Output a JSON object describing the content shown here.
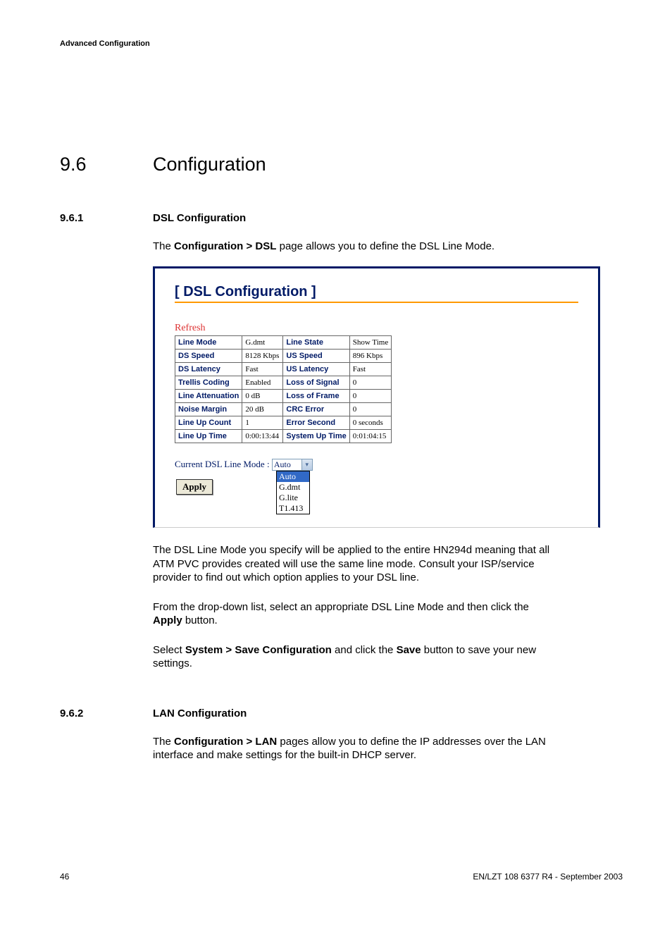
{
  "header": {
    "running": "Advanced Configuration"
  },
  "section": {
    "num": "9.6",
    "title": "Configuration"
  },
  "sub1": {
    "num": "9.6.1",
    "title": "DSL Configuration",
    "intro_pre": "The ",
    "intro_bold": "Configuration > DSL",
    "intro_post": " page allows you to define the DSL Line Mode."
  },
  "panel": {
    "title": "[ DSL Configuration ]",
    "refresh": "Refresh",
    "linemode_label": "Current DSL Line Mode :",
    "selected_option": "Auto",
    "options": [
      "Auto",
      "G.dmt",
      "G.lite",
      "T1.413"
    ],
    "apply": "Apply"
  },
  "table": {
    "rows": [
      {
        "h1": "Line Mode",
        "v1": "G.dmt",
        "h2": "Line State",
        "v2": "Show Time"
      },
      {
        "h1": "DS Speed",
        "v1": "8128 Kbps",
        "h2": "US Speed",
        "v2": "896 Kbps"
      },
      {
        "h1": "DS Latency",
        "v1": "Fast",
        "h2": "US Latency",
        "v2": "Fast"
      },
      {
        "h1": "Trellis Coding",
        "v1": "Enabled",
        "h2": "Loss of Signal",
        "v2": "0"
      },
      {
        "h1": "Line Attenuation",
        "v1": "0 dB",
        "h2": "Loss of Frame",
        "v2": "0"
      },
      {
        "h1": "Noise Margin",
        "v1": "20 dB",
        "h2": "CRC Error",
        "v2": "0"
      },
      {
        "h1": "Line Up Count",
        "v1": "1",
        "h2": "Error Second",
        "v2": "0 seconds"
      },
      {
        "h1": "Line Up Time",
        "v1": "0:00:13:44",
        "h2": "System Up Time",
        "v2": "0:01:04:15"
      }
    ]
  },
  "body1": "The DSL Line Mode you specify will be applied to the entire HN294d meaning that all ATM PVC provides created will use the same line mode. Consult your ISP/service provider to find out which option applies to your DSL line.",
  "body2_pre": "From the drop-down list, select an appropriate DSL Line Mode and then click the ",
  "body2_bold": "Apply",
  "body2_post": " button.",
  "body3_pre": "Select ",
  "body3_bold1": "System > Save Configuration",
  "body3_mid": " and click the ",
  "body3_bold2": "Save",
  "body3_post": " button to save your new settings.",
  "sub2": {
    "num": "9.6.2",
    "title": "LAN Configuration",
    "intro_pre": "The ",
    "intro_bold": "Configuration > LAN",
    "intro_post": " pages allow you to define the IP addresses over the LAN interface and make settings for the built-in DHCP server."
  },
  "footer": {
    "page": "46",
    "docid": "EN/LZT 108 6377 R4 - September 2003"
  }
}
